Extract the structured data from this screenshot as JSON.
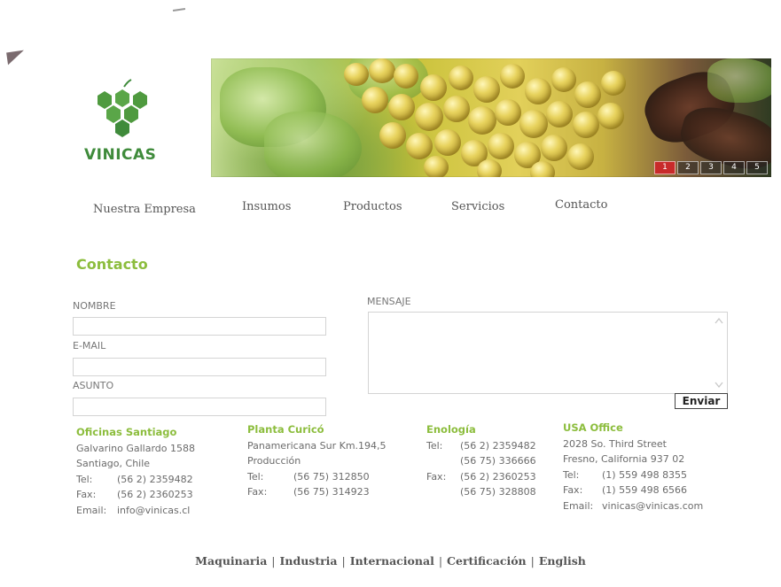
{
  "brand": {
    "name": "VINICAS",
    "logo_icon": "grape-cluster-icon",
    "accent": "#8cbd3d",
    "logo_color": "#3f8b3b"
  },
  "banner": {
    "pager": [
      "1",
      "2",
      "3",
      "4",
      "5"
    ],
    "active_slide": "1",
    "active_color": "#c82a2a"
  },
  "nav": {
    "items": [
      "Nuestra Empresa",
      "Insumos",
      "Productos",
      "Servicios",
      "Contacto"
    ]
  },
  "contact_form": {
    "title": "Contacto",
    "name_label": "NOMBRE",
    "email_label": "E-MAIL",
    "subject_label": "ASUNTO",
    "message_label": "MENSAJE",
    "name_value": "",
    "email_value": "",
    "subject_value": "",
    "message_value": "",
    "submit_label": "Enviar"
  },
  "offices": [
    {
      "title": "Oficinas Santiago",
      "lines": [
        "Galvarino Gallardo 1588",
        "Santiago, Chile"
      ],
      "tel_label": "Tel:",
      "tel": "(56 2) 2359482",
      "fax_label": "Fax:",
      "fax": "(56 2) 2360253",
      "email_label": "Email:",
      "email": "info@vinicas.cl"
    },
    {
      "title": "Planta Curicó",
      "lines": [
        "Panamericana Sur Km.194,5",
        "Producción"
      ],
      "tel_label": "Tel:",
      "tel": "(56 75) 312850",
      "fax_label": "Fax:",
      "fax": "(56 75) 314923"
    },
    {
      "title": "Enología",
      "tel_label": "Tel:",
      "tel": "(56 2) 2359482",
      "tel2": "(56 75) 336666",
      "fax_label": "Fax:",
      "fax": "(56 2) 2360253",
      "fax2": "(56 75) 328808"
    },
    {
      "title": "USA Office",
      "lines": [
        "2028 So. Third Street",
        "Fresno, California 937 02"
      ],
      "tel_label": "Tel:",
      "tel": "(1) 559 498 8355",
      "fax_label": "Fax:",
      "fax": "(1) 559 498 6566",
      "email_label": "Email:",
      "email": "vinicas@vinicas.com"
    }
  ],
  "footer_links": [
    "Maquinaria",
    "Industria",
    "Internacional",
    "Certificación",
    "English"
  ],
  "footer_separator": "|"
}
